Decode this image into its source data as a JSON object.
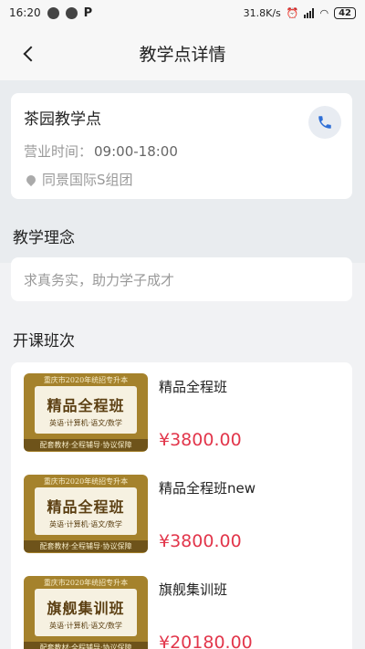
{
  "status": {
    "time": "16:20",
    "network_speed": "31.8K/s",
    "battery": "42"
  },
  "nav": {
    "title": "教学点详情"
  },
  "site": {
    "name": "茶园教学点",
    "hours_label": "营业时间：",
    "hours_value": "09:00-18:00",
    "address": "同景国际S组团"
  },
  "philosophy": {
    "title": "教学理念",
    "text": "求真务实，助力学子成才"
  },
  "courses": {
    "title": "开课班次",
    "items": [
      {
        "name": "精品全程班",
        "price": "¥3800.00",
        "cover_top": "重庆市2020年统招专升本",
        "cover_main": "精品全程班",
        "cover_sub": "英语·计算机·语文/数学",
        "cover_bottom": "配套教材·全程辅导·协议保障"
      },
      {
        "name": "精品全程班new",
        "price": "¥3800.00",
        "cover_top": "重庆市2020年统招专升本",
        "cover_main": "精品全程班",
        "cover_sub": "英语·计算机·语文/数学",
        "cover_bottom": "配套教材·全程辅导·协议保障"
      },
      {
        "name": "旗舰集训班",
        "price": "¥20180.00",
        "cover_top": "重庆市2020年统招专升本",
        "cover_main": "旗舰集训班",
        "cover_sub": "英语·计算机·语文/数学",
        "cover_bottom": "配套教材·全程辅导·协议保障"
      }
    ]
  },
  "colors": {
    "price": "#e2364b",
    "cover": "#a5822c",
    "accent": "#2f6fd6"
  }
}
